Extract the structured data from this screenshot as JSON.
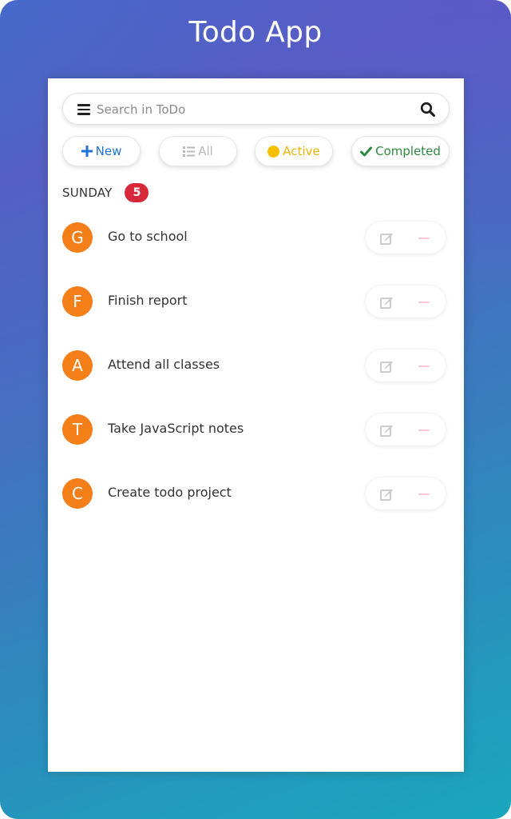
{
  "app": {
    "title": "Todo App"
  },
  "search": {
    "placeholder": "Search in ToDo"
  },
  "filters": {
    "new_label": "New",
    "all_label": "All",
    "active_label": "Active",
    "completed_label": "Completed"
  },
  "day": {
    "label": "SUNDAY",
    "count": "5"
  },
  "todos": [
    {
      "initial": "G",
      "text": "Go to school"
    },
    {
      "initial": "F",
      "text": "Finish report"
    },
    {
      "initial": "A",
      "text": "Attend all classes"
    },
    {
      "initial": "T",
      "text": "Take JavaScript notes"
    },
    {
      "initial": "C",
      "text": "Create todo project"
    }
  ],
  "colors": {
    "avatar": "#f47e17",
    "badge": "#d7283a",
    "new": "#1f73d8",
    "active": "#f0b400",
    "completed": "#2e8a3e"
  },
  "icons": {
    "menu": "menu-icon",
    "search": "search-icon",
    "new": "plus-icon",
    "all": "list-icon",
    "active": "circle-icon",
    "completed": "check-icon",
    "edit": "edit-icon",
    "delete": "minus-icon"
  }
}
